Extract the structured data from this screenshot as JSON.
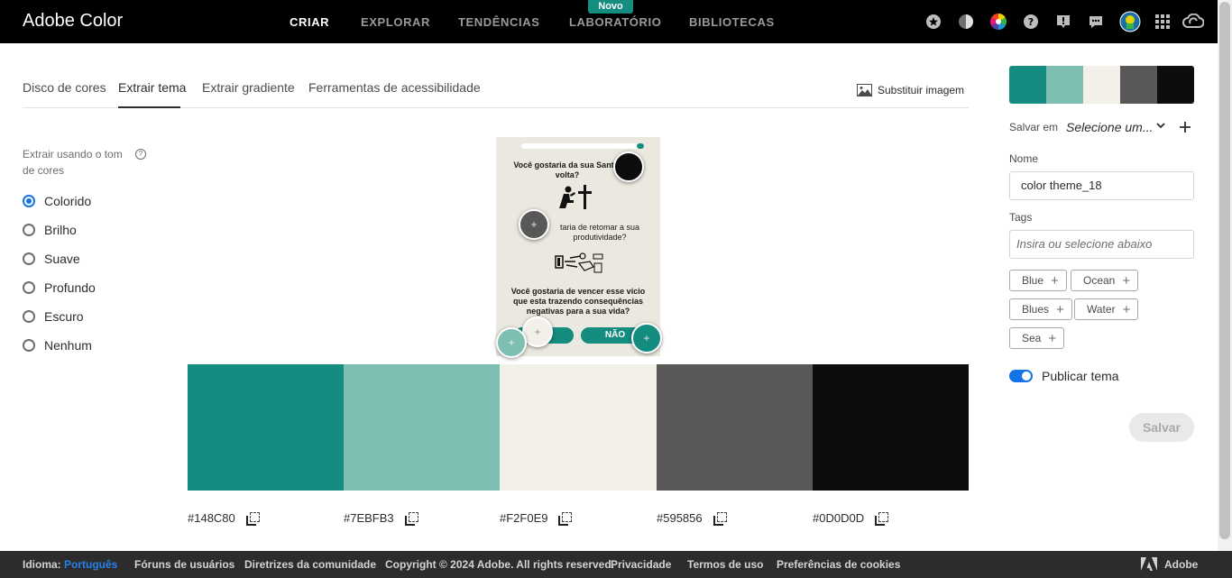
{
  "app": {
    "title": "Adobe Color",
    "nav": [
      {
        "label": "CRIAR",
        "active": true
      },
      {
        "label": "EXPLORAR",
        "active": false
      },
      {
        "label": "TENDÊNCIAS",
        "active": false
      },
      {
        "label": "LABORATÓRIO",
        "active": false
      },
      {
        "label": "BIBLIOTECAS",
        "active": false
      }
    ],
    "new_badge": "Novo",
    "header_icons": [
      "star-icon",
      "contrast-icon",
      "color-wheel-icon",
      "help-icon",
      "alert-icon",
      "feedback-icon",
      "avatar",
      "apps-grid-icon",
      "creative-cloud-icon"
    ]
  },
  "tabs": [
    {
      "label": "Disco de cores",
      "active": false
    },
    {
      "label": "Extrair tema",
      "active": true
    },
    {
      "label": "Extrair gradiente",
      "active": false
    },
    {
      "label": "Ferramentas de acessibilidade",
      "active": false
    }
  ],
  "replace_image_label": "Substituir imagem",
  "mood": {
    "title": "Extrair usando o tom de cores",
    "options": [
      {
        "label": "Colorido",
        "checked": true
      },
      {
        "label": "Brilho",
        "checked": false
      },
      {
        "label": "Suave",
        "checked": false
      },
      {
        "label": "Profundo",
        "checked": false
      },
      {
        "label": "Escuro",
        "checked": false
      },
      {
        "label": "Nenhum",
        "checked": false
      }
    ]
  },
  "preview": {
    "q1": "Você gostaria da sua Santid volta?",
    "q2": "taria de retomar a sua produtividade?",
    "q3": "Você gostaria de vencer esse vicio que esta trazendo consequências negativas para a sua vida?",
    "no_button": "NÃO"
  },
  "swatches": [
    {
      "hex": "#148C80",
      "color": "#148c80"
    },
    {
      "hex": "#7EBFB3",
      "color": "#7ebfb3"
    },
    {
      "hex": "#F2F0E9",
      "color": "#f2f0e9"
    },
    {
      "hex": "#595856",
      "color": "#595856"
    },
    {
      "hex": "#0D0D0D",
      "color": "#0d0d0d"
    }
  ],
  "sidebar": {
    "save_in_label": "Salvar em",
    "library_select": "Selecione um...",
    "name_label": "Nome",
    "name_value": "color theme_18",
    "tags_label": "Tags",
    "tags_placeholder": "Insira ou selecione abaixo",
    "tag_suggestions": [
      "Blue",
      "Ocean",
      "Blues",
      "Water",
      "Sea"
    ],
    "publish_label": "Publicar tema",
    "publish_on": true,
    "save_button": "Salvar"
  },
  "footer": {
    "language_label": "Idioma:",
    "language_value": "Português",
    "links": [
      "Fóruns de usuários",
      "Diretrizes da comunidade",
      "Copyright © 2024 Adobe. All rights reserved.",
      "Privacidade",
      "Termos de uso",
      "Preferências de cookies"
    ],
    "brand": "Adobe"
  }
}
